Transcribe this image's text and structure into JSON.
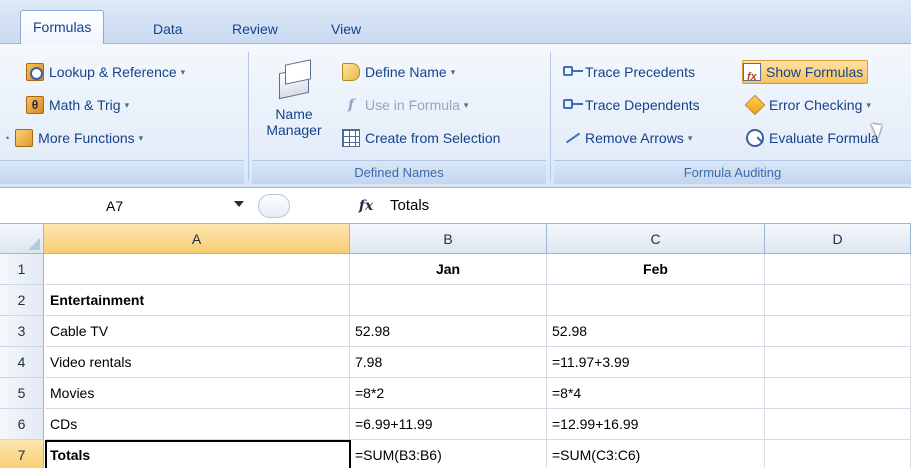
{
  "ribbon_tabs": [
    "Formulas",
    "Data",
    "Review",
    "View"
  ],
  "function_library": {
    "lookup": "Lookup & Reference",
    "math": "Math & Trig",
    "more": "More Functions"
  },
  "defined_names": {
    "name_manager_line1": "Name",
    "name_manager_line2": "Manager",
    "define_name": "Define Name",
    "use_in_formula": "Use in Formula",
    "create_from_selection": "Create from Selection",
    "caption": "Defined Names"
  },
  "formula_auditing": {
    "trace_precedents": "Trace Precedents",
    "trace_dependents": "Trace Dependents",
    "remove_arrows": "Remove Arrows",
    "show_formulas": "Show Formulas",
    "error_checking": "Error Checking",
    "evaluate_formula": "Evaluate Formula",
    "caption": "Formula Auditing"
  },
  "formula_bar": {
    "name_box": "A7",
    "fx": "fx",
    "value": "Totals"
  },
  "grid": {
    "columns": [
      "A",
      "B",
      "C",
      "D"
    ],
    "rows": [
      {
        "num": "1",
        "A": "",
        "B": "Jan",
        "C": "Feb",
        "D": ""
      },
      {
        "num": "2",
        "A": "Entertainment",
        "B": "",
        "C": "",
        "D": ""
      },
      {
        "num": "3",
        "A": "Cable TV",
        "B": "52.98",
        "C": "52.98",
        "D": ""
      },
      {
        "num": "4",
        "A": "Video rentals",
        "B": "7.98",
        "C": "=11.97+3.99",
        "D": ""
      },
      {
        "num": "5",
        "A": "Movies",
        "B": "=8*2",
        "C": "=8*4",
        "D": ""
      },
      {
        "num": "6",
        "A": "CDs",
        "B": "=6.99+11.99",
        "C": "=12.99+16.99",
        "D": ""
      },
      {
        "num": "7",
        "A": "Totals",
        "B": "=SUM(B3:B6)",
        "C": "=SUM(C3:C6)",
        "D": ""
      }
    ]
  },
  "colors": {
    "ribbon_text": "#15428b",
    "selected_header": "#f8cd72",
    "show_formulas_highlight": "#f9c25e"
  }
}
